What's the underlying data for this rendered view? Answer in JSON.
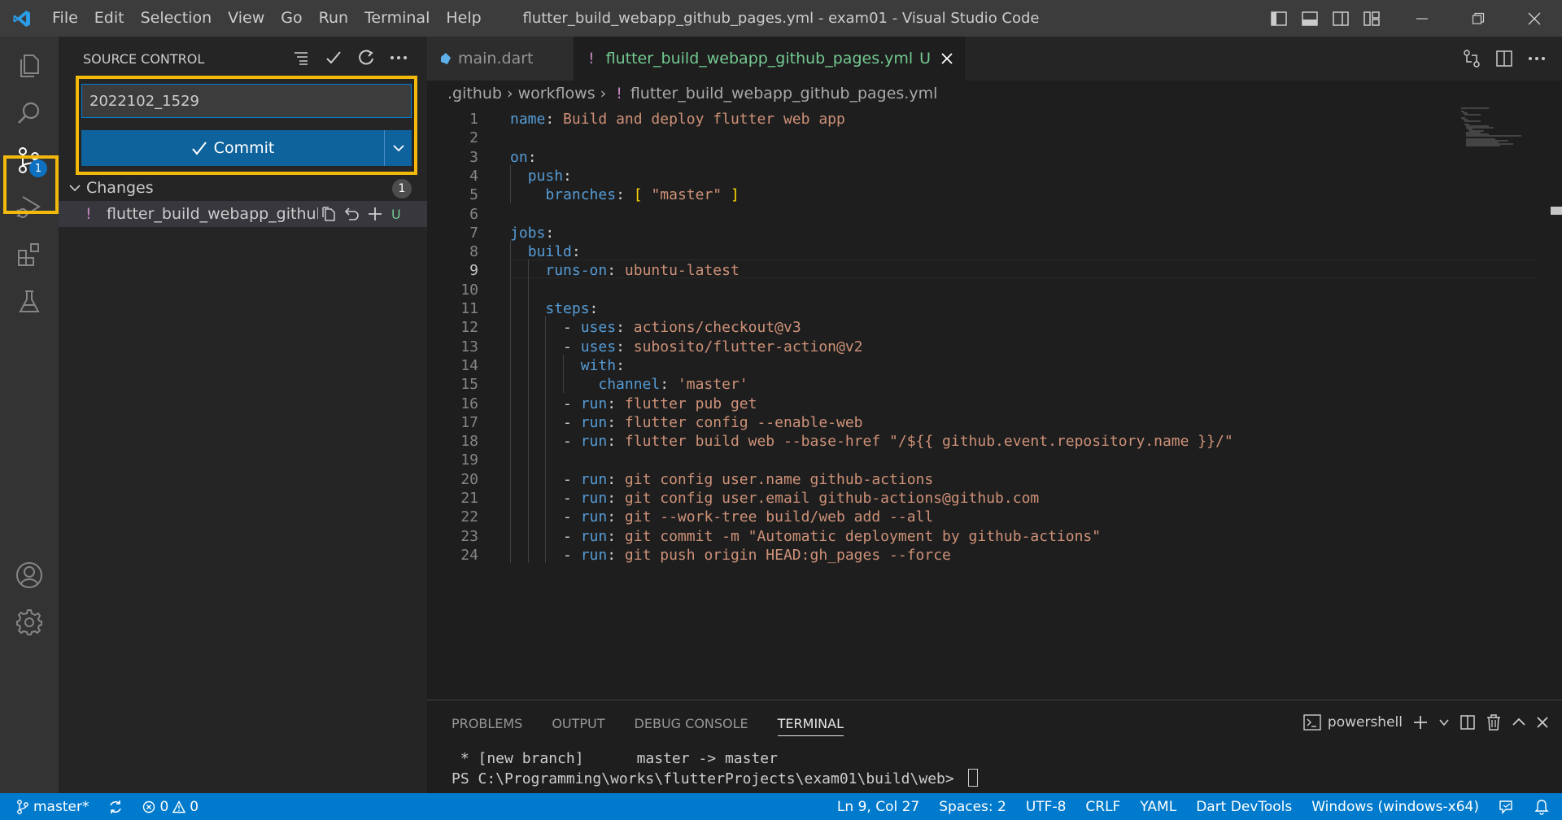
{
  "titlebar": {
    "menu": [
      "File",
      "Edit",
      "Selection",
      "View",
      "Go",
      "Run",
      "Terminal",
      "Help"
    ],
    "window_title": "flutter_build_webapp_github_pages.yml - exam01 - Visual Studio Code",
    "icons": [
      "vscode-logo-icon",
      "toggle-sidebar-icon",
      "toggle-panel-icon",
      "toggle-secondary-sidebar-icon",
      "customize-layout-icon",
      "minimize-icon",
      "restore-icon",
      "close-icon"
    ]
  },
  "activity_bar": {
    "items": [
      "explorer-icon",
      "search-icon",
      "source-control-icon",
      "run-debug-icon",
      "extensions-icon",
      "testing-icon",
      "accounts-icon",
      "manage-icon"
    ],
    "source_control_badge": "1"
  },
  "sidebar": {
    "title": "SOURCE CONTROL",
    "actions": [
      "view-as-tree-icon",
      "commit-check-icon",
      "refresh-icon",
      "more-actions-icon"
    ],
    "commit_message": "2022102_1529",
    "commit_button": "Commit",
    "changes_label": "Changes",
    "changes_count": "1",
    "file": {
      "indicator": "!",
      "name": "flutter_build_webapp_github...",
      "status": "U"
    }
  },
  "tabs": [
    {
      "label": "main.dart",
      "active": false
    },
    {
      "label": "flutter_build_webapp_github_pages.yml",
      "status": "U",
      "indicator": "!",
      "active": true
    }
  ],
  "breadcrumb": [
    ".github",
    "workflows",
    "flutter_build_webapp_github_pages.yml"
  ],
  "editor": {
    "current_line": 9,
    "line_numbers": [
      "1",
      "2",
      "3",
      "4",
      "5",
      "6",
      "7",
      "8",
      "9",
      "10",
      "11",
      "12",
      "13",
      "14",
      "15",
      "16",
      "17",
      "18",
      "19",
      "20",
      "21",
      "22",
      "23",
      "24"
    ],
    "lines": [
      [
        [
          "k",
          "name"
        ],
        [
          "p",
          ": "
        ],
        [
          "s",
          "Build and deploy flutter web app"
        ]
      ],
      [],
      [
        [
          "k",
          "on"
        ],
        [
          "p",
          ":"
        ]
      ],
      [
        [
          "p",
          "  "
        ],
        [
          "k",
          "push"
        ],
        [
          "p",
          ":"
        ]
      ],
      [
        [
          "p",
          "    "
        ],
        [
          "k",
          "branches"
        ],
        [
          "p",
          ": "
        ],
        [
          "b",
          "["
        ],
        [
          "p",
          " "
        ],
        [
          "s",
          "\"master\""
        ],
        [
          "p",
          " "
        ],
        [
          "b",
          "]"
        ]
      ],
      [],
      [
        [
          "k",
          "jobs"
        ],
        [
          "p",
          ":"
        ]
      ],
      [
        [
          "p",
          "  "
        ],
        [
          "k",
          "build"
        ],
        [
          "p",
          ":"
        ]
      ],
      [
        [
          "p",
          "    "
        ],
        [
          "k",
          "runs-on"
        ],
        [
          "p",
          ": "
        ],
        [
          "s",
          "ubuntu-latest"
        ]
      ],
      [],
      [
        [
          "p",
          "    "
        ],
        [
          "k",
          "steps"
        ],
        [
          "p",
          ":"
        ]
      ],
      [
        [
          "p",
          "      - "
        ],
        [
          "k",
          "uses"
        ],
        [
          "p",
          ": "
        ],
        [
          "s",
          "actions/checkout@v3"
        ]
      ],
      [
        [
          "p",
          "      - "
        ],
        [
          "k",
          "uses"
        ],
        [
          "p",
          ": "
        ],
        [
          "s",
          "subosito/flutter-action@v2"
        ]
      ],
      [
        [
          "p",
          "        "
        ],
        [
          "k",
          "with"
        ],
        [
          "p",
          ":"
        ]
      ],
      [
        [
          "p",
          "          "
        ],
        [
          "k",
          "channel"
        ],
        [
          "p",
          ": "
        ],
        [
          "s",
          "'master'"
        ]
      ],
      [
        [
          "p",
          "      - "
        ],
        [
          "k",
          "run"
        ],
        [
          "p",
          ": "
        ],
        [
          "s",
          "flutter pub get"
        ]
      ],
      [
        [
          "p",
          "      - "
        ],
        [
          "k",
          "run"
        ],
        [
          "p",
          ": "
        ],
        [
          "s",
          "flutter config --enable-web"
        ]
      ],
      [
        [
          "p",
          "      - "
        ],
        [
          "k",
          "run"
        ],
        [
          "p",
          ": "
        ],
        [
          "s",
          "flutter build web --base-href \"/${{ github.event.repository.name }}/\""
        ]
      ],
      [],
      [
        [
          "p",
          "      - "
        ],
        [
          "k",
          "run"
        ],
        [
          "p",
          ": "
        ],
        [
          "s",
          "git config user.name github-actions"
        ]
      ],
      [
        [
          "p",
          "      - "
        ],
        [
          "k",
          "run"
        ],
        [
          "p",
          ": "
        ],
        [
          "s",
          "git config user.email github-actions@github.com"
        ]
      ],
      [
        [
          "p",
          "      - "
        ],
        [
          "k",
          "run"
        ],
        [
          "p",
          ": "
        ],
        [
          "s",
          "git --work-tree build/web add --all"
        ]
      ],
      [
        [
          "p",
          "      - "
        ],
        [
          "k",
          "run"
        ],
        [
          "p",
          ": "
        ],
        [
          "s",
          "git commit -m \"Automatic deployment by github-actions\""
        ]
      ],
      [
        [
          "p",
          "      - "
        ],
        [
          "k",
          "run"
        ],
        [
          "p",
          ": "
        ],
        [
          "s",
          "git push origin HEAD:gh_pages --force"
        ]
      ]
    ]
  },
  "panel": {
    "tabs": [
      "PROBLEMS",
      "OUTPUT",
      "DEBUG CONSOLE",
      "TERMINAL"
    ],
    "active_tab": "TERMINAL",
    "shell": "powershell",
    "terminal_lines": [
      " * [new branch]      master -> master",
      "PS C:\\Programming\\works\\flutterProjects\\exam01\\build\\web> "
    ]
  },
  "statusbar": {
    "branch": "master*",
    "errors": "0",
    "warnings": "0",
    "cursor": "Ln 9, Col 27",
    "spaces": "Spaces: 2",
    "encoding": "UTF-8",
    "eol": "CRLF",
    "language": "YAML",
    "devtools": "Dart DevTools",
    "platform": "Windows (windows-x64)"
  },
  "colors": {
    "accent": "#007acc",
    "highlight": "#f2b80c",
    "button": "#0e639c",
    "untracked": "#73c991",
    "yaml_key": "#569cd6",
    "yaml_string": "#ce9178"
  }
}
